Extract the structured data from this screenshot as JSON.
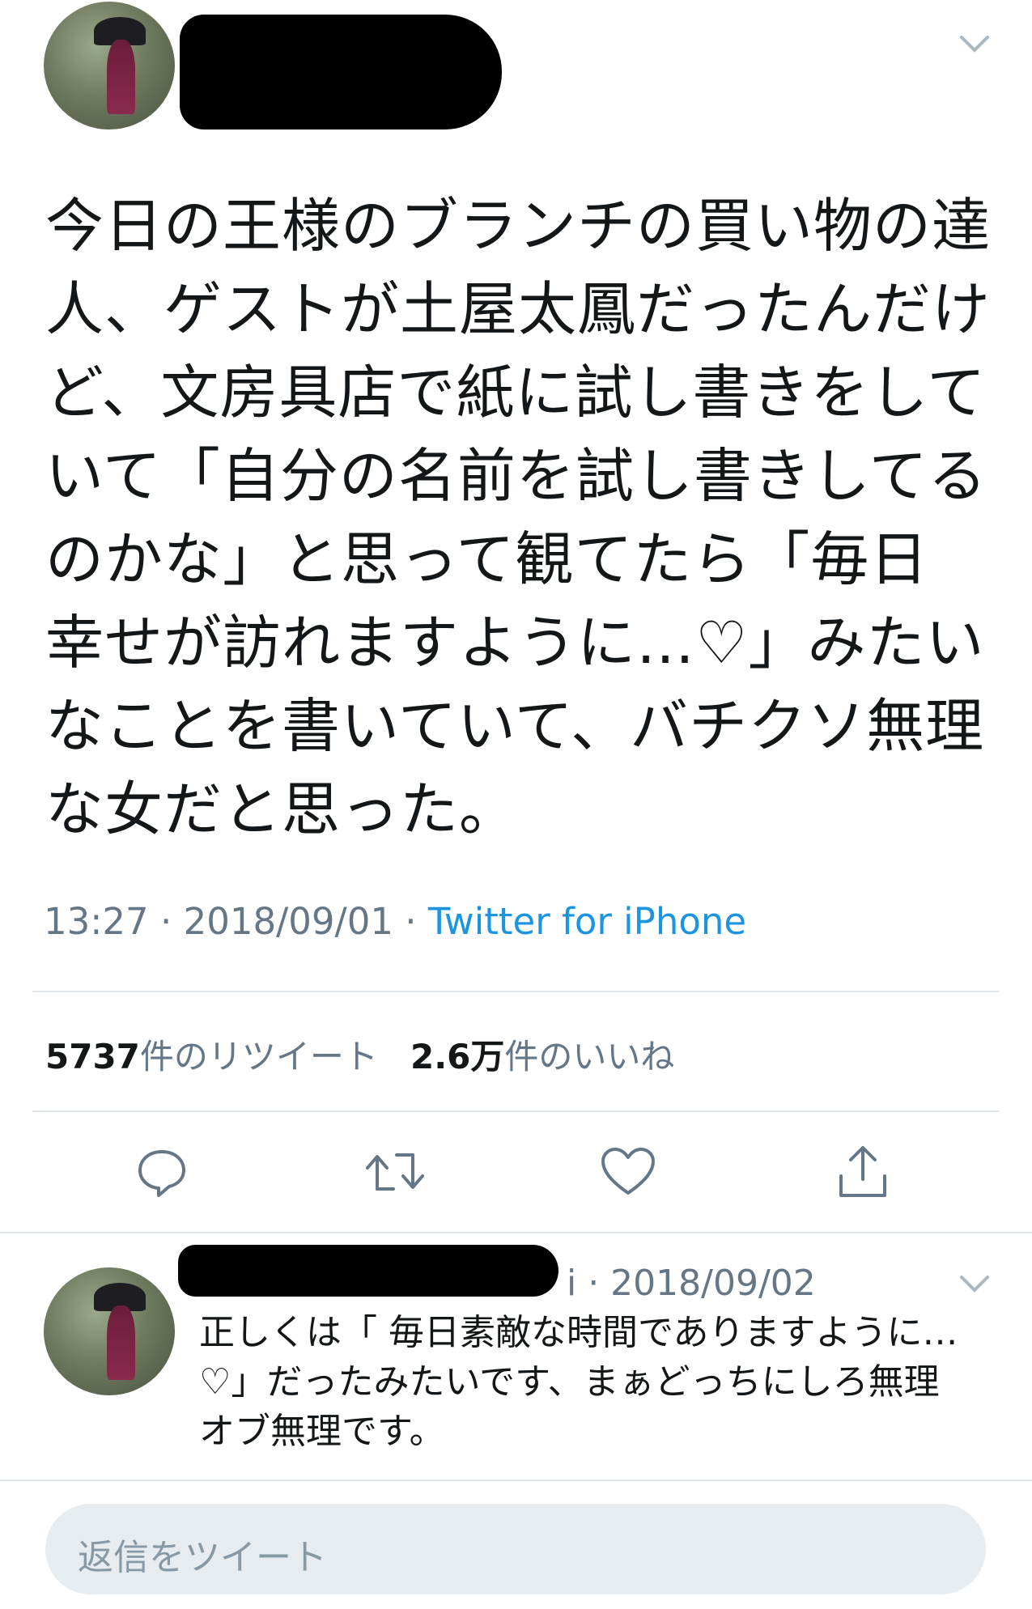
{
  "tweet": {
    "text": "今日の王様のブランチの買い物の達\n人、ゲストが土屋太鳳だったんだけ\nど、文房具店で紙に試し書きをして\nいて「自分の名前を試し書きしてる\nのかな」と思って観てたら「毎日\n幸せが訪れますように…♡」みたい\nなことを書いていて、バチクソ無理\nな女だと思った。",
    "time": "13:27 · 2018/09/01 · ",
    "source": "Twitter for iPhone"
  },
  "stats": {
    "retweets_count": "5737",
    "retweets_label": "件のリツイート",
    "likes_count": "2.6万",
    "likes_label": "件のいいね"
  },
  "actions": {
    "reply_icon": "reply-icon",
    "retweet_icon": "retweet-icon",
    "like_icon": "heart-icon",
    "share_icon": "share-icon"
  },
  "reply": {
    "meta": "i · 2018/09/02",
    "text": "正しくは「 毎日素敵な時間でありますように…\n♡」だったみたいです、まぁどっちにしろ無理\nオブ無理です。"
  },
  "compose": {
    "placeholder": "返信をツイート"
  },
  "colors": {
    "accent": "#1b95e0",
    "secondary_text": "#657786",
    "divider": "#e1e8ed",
    "compose_bg": "#e6ecf0"
  }
}
